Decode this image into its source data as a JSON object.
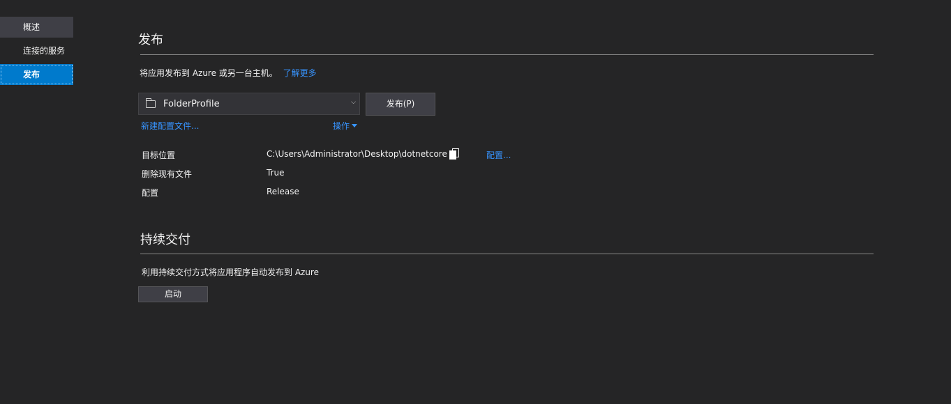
{
  "sidebar": {
    "items": [
      {
        "label": "概述"
      },
      {
        "label": "连接的服务"
      },
      {
        "label": "发布"
      }
    ]
  },
  "publish": {
    "title": "发布",
    "description": "将应用发布到 Azure 或另一台主机。",
    "learn_more": "了解更多",
    "profile": "FolderProfile",
    "publish_button": "发布(P)",
    "new_profile_link": "新建配置文件...",
    "actions_link": "操作",
    "properties": [
      {
        "label": "目标位置",
        "value": "C:\\Users\\Administrator\\Desktop\\dotnetcore",
        "action": "配置..."
      },
      {
        "label": "删除现有文件",
        "value": "True"
      },
      {
        "label": "配置",
        "value": "Release"
      }
    ]
  },
  "cd": {
    "title": "持续交付",
    "description": "利用持续交付方式将应用程序自动发布到 Azure",
    "start_button": "启动"
  },
  "colors": {
    "background": "#252526",
    "accent": "#007acc",
    "link": "#3794ff"
  }
}
